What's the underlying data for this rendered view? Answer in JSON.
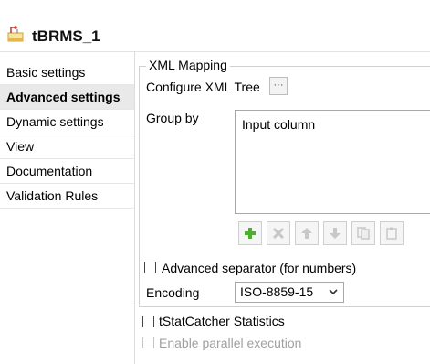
{
  "header": {
    "title": "tBRMS_1",
    "icon": "component-icon"
  },
  "sidebar": {
    "items": [
      {
        "label": "Basic settings",
        "selected": false
      },
      {
        "label": "Advanced settings",
        "selected": true
      },
      {
        "label": "Dynamic settings",
        "selected": false
      },
      {
        "label": "View",
        "selected": false
      },
      {
        "label": "Documentation",
        "selected": false
      },
      {
        "label": "Validation Rules",
        "selected": false
      }
    ]
  },
  "main": {
    "group_title": "XML Mapping",
    "configure_label": "Configure XML Tree",
    "configure_button": "···",
    "group_by_label": "Group by",
    "table": {
      "columns": [
        "Input column"
      ]
    },
    "toolbar": [
      "add",
      "remove",
      "move-up",
      "move-down",
      "copy",
      "paste"
    ],
    "advanced_separator": {
      "label": "Advanced separator (for numbers)",
      "checked": false
    },
    "encoding": {
      "label": "Encoding",
      "value": "ISO-8859-15"
    },
    "tstatcatcher": {
      "label": "tStatCatcher Statistics",
      "checked": false
    },
    "parallel": {
      "label": "Enable parallel execution",
      "checked": false,
      "enabled": false
    }
  },
  "colors": {
    "selected_bg": "#e9e9e9",
    "add_icon": "#4caf2d",
    "disabled_icon": "#c8c8c8"
  }
}
